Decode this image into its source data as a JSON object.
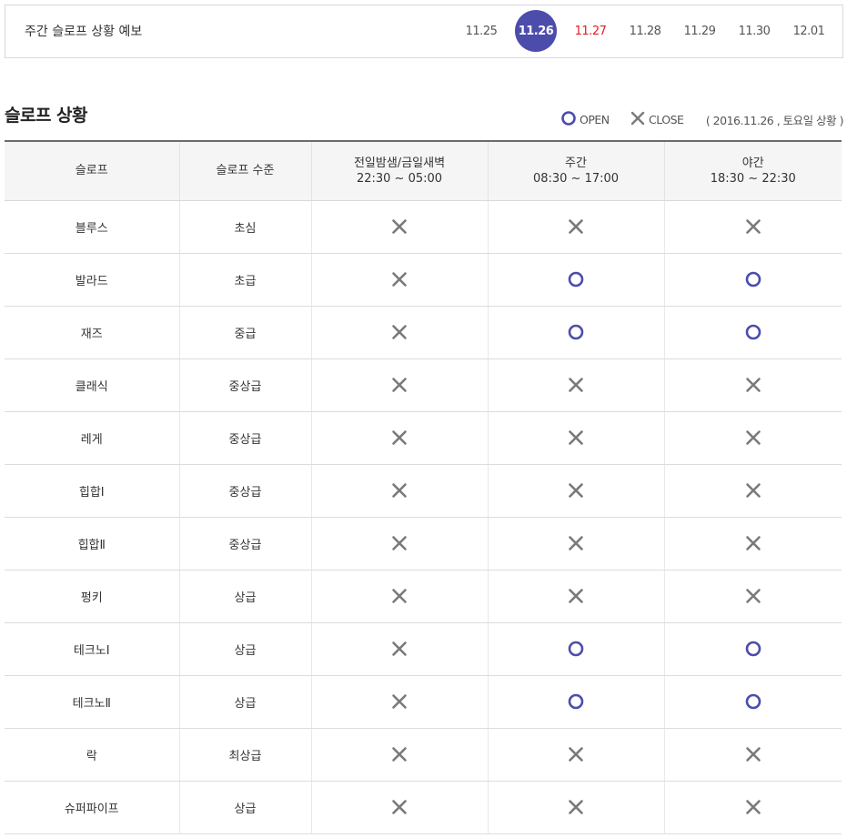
{
  "weekly_forecast": {
    "title": "주간 슬로프 상황 예보",
    "dates": [
      {
        "label": "11.25",
        "state": "normal"
      },
      {
        "label": "11.26",
        "state": "selected"
      },
      {
        "label": "11.27",
        "state": "holiday"
      },
      {
        "label": "11.28",
        "state": "normal"
      },
      {
        "label": "11.29",
        "state": "normal"
      },
      {
        "label": "11.30",
        "state": "normal"
      },
      {
        "label": "12.01",
        "state": "normal"
      }
    ]
  },
  "section": {
    "title": "슬로프 상황",
    "legend_open": "OPEN",
    "legend_close": "CLOSE",
    "date_note": "( 2016.11.26 , 토요일 상황 )"
  },
  "colors": {
    "accent": "#4c4dab",
    "holiday": "#e02020",
    "close_mark": "#7a7a7a"
  },
  "icons": {
    "open": "circle-icon",
    "close": "x-icon"
  },
  "table": {
    "headers": [
      {
        "title": "슬로프",
        "sub": ""
      },
      {
        "title": "슬로프 수준",
        "sub": ""
      },
      {
        "title": "전일밤샘/금일새벽",
        "sub": "22:30 ~ 05:00"
      },
      {
        "title": "주간",
        "sub": "08:30 ~ 17:00"
      },
      {
        "title": "야간",
        "sub": "18:30 ~ 22:30"
      }
    ],
    "rows": [
      {
        "slope": "블루스",
        "level": "초심",
        "overnight": "close",
        "day": "close",
        "night": "close"
      },
      {
        "slope": "발라드",
        "level": "초급",
        "overnight": "close",
        "day": "open",
        "night": "open"
      },
      {
        "slope": "재즈",
        "level": "중급",
        "overnight": "close",
        "day": "open",
        "night": "open"
      },
      {
        "slope": "클래식",
        "level": "중상급",
        "overnight": "close",
        "day": "close",
        "night": "close"
      },
      {
        "slope": "레게",
        "level": "중상급",
        "overnight": "close",
        "day": "close",
        "night": "close"
      },
      {
        "slope": "힙합Ⅰ",
        "level": "중상급",
        "overnight": "close",
        "day": "close",
        "night": "close"
      },
      {
        "slope": "힙합Ⅱ",
        "level": "중상급",
        "overnight": "close",
        "day": "close",
        "night": "close"
      },
      {
        "slope": "펑키",
        "level": "상급",
        "overnight": "close",
        "day": "close",
        "night": "close"
      },
      {
        "slope": "테크노Ⅰ",
        "level": "상급",
        "overnight": "close",
        "day": "open",
        "night": "open"
      },
      {
        "slope": "테크노Ⅱ",
        "level": "상급",
        "overnight": "close",
        "day": "open",
        "night": "open"
      },
      {
        "slope": "락",
        "level": "최상급",
        "overnight": "close",
        "day": "close",
        "night": "close"
      },
      {
        "slope": "슈퍼파이프",
        "level": "상급",
        "overnight": "close",
        "day": "close",
        "night": "close"
      }
    ]
  }
}
